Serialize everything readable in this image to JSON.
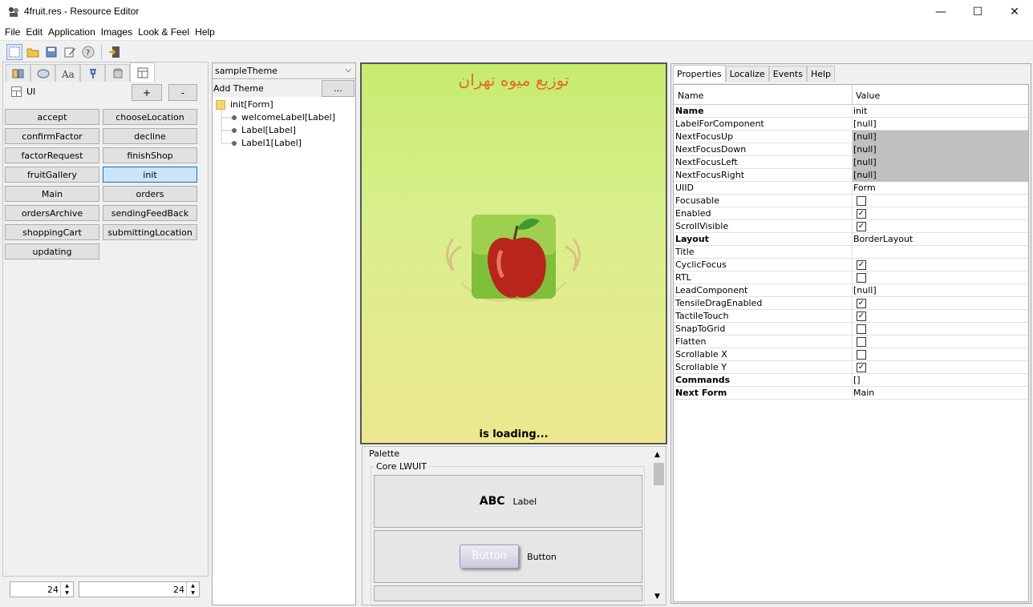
{
  "window": {
    "title": "4fruit.res - Resource Editor",
    "minimize": "—",
    "maximize": "☐",
    "close": "✕"
  },
  "menu": [
    "File",
    "Edit",
    "Application",
    "Images",
    "Look & Feel",
    "Help"
  ],
  "left": {
    "section_label": "UI",
    "add_label": "+",
    "remove_label": "-",
    "forms": [
      "accept",
      "chooseLocation",
      "confirmFactor",
      "decline",
      "factorRequest",
      "finishShop",
      "fruitGallery",
      "init",
      "Main",
      "orders",
      "ordersArchive",
      "sendingFeedBack",
      "shoppingCart",
      "submittingLocation",
      "updating"
    ],
    "selected_form": "init",
    "spinner1": "24",
    "spinner2": "24"
  },
  "tree": {
    "theme": "sampleTheme",
    "add_theme_label": "Add Theme",
    "more_label": "...",
    "root": "init[Form]",
    "children": [
      "welcomeLabel[Label]",
      "Label[Label]",
      "Label1[Label]"
    ]
  },
  "preview": {
    "title": "توزیع میوه تهران",
    "loading": "is loading..."
  },
  "palette": {
    "title": "Palette",
    "group": "Core LWUIT",
    "label_sample": "ABC",
    "label_name": "Label",
    "button_sample": "Button",
    "button_name": "Button"
  },
  "props": {
    "tabs": [
      "Properties",
      "Localize",
      "Events",
      "Help"
    ],
    "col_name": "Name",
    "col_value": "Value",
    "rows": [
      {
        "name": "Name",
        "value": "init",
        "bold": true
      },
      {
        "name": "LabelForComponent",
        "value": "[null]"
      },
      {
        "name": "NextFocusUp",
        "value": "[null]",
        "gray": true
      },
      {
        "name": "NextFocusDown",
        "value": "[null]",
        "gray": true
      },
      {
        "name": "NextFocusLeft",
        "value": "[null]",
        "gray": true
      },
      {
        "name": "NextFocusRight",
        "value": "[null]",
        "gray": true
      },
      {
        "name": "UIID",
        "value": "Form"
      },
      {
        "name": "Focusable",
        "check": false
      },
      {
        "name": "Enabled",
        "check": true
      },
      {
        "name": "ScrollVisible",
        "check": true
      },
      {
        "name": "Layout",
        "value": "BorderLayout",
        "bold": true
      },
      {
        "name": "Title",
        "value": ""
      },
      {
        "name": "CyclicFocus",
        "check": true
      },
      {
        "name": "RTL",
        "check": false
      },
      {
        "name": "LeadComponent",
        "value": "[null]"
      },
      {
        "name": "TensileDragEnabled",
        "check": true
      },
      {
        "name": "TactileTouch",
        "check": true
      },
      {
        "name": "SnapToGrid",
        "check": false
      },
      {
        "name": "Flatten",
        "check": false
      },
      {
        "name": "Scrollable X",
        "check": false
      },
      {
        "name": "Scrollable Y",
        "check": true
      },
      {
        "name": "Commands",
        "value": "[]",
        "bold": true
      },
      {
        "name": "Next Form",
        "value": "Main",
        "bold": true
      }
    ]
  }
}
